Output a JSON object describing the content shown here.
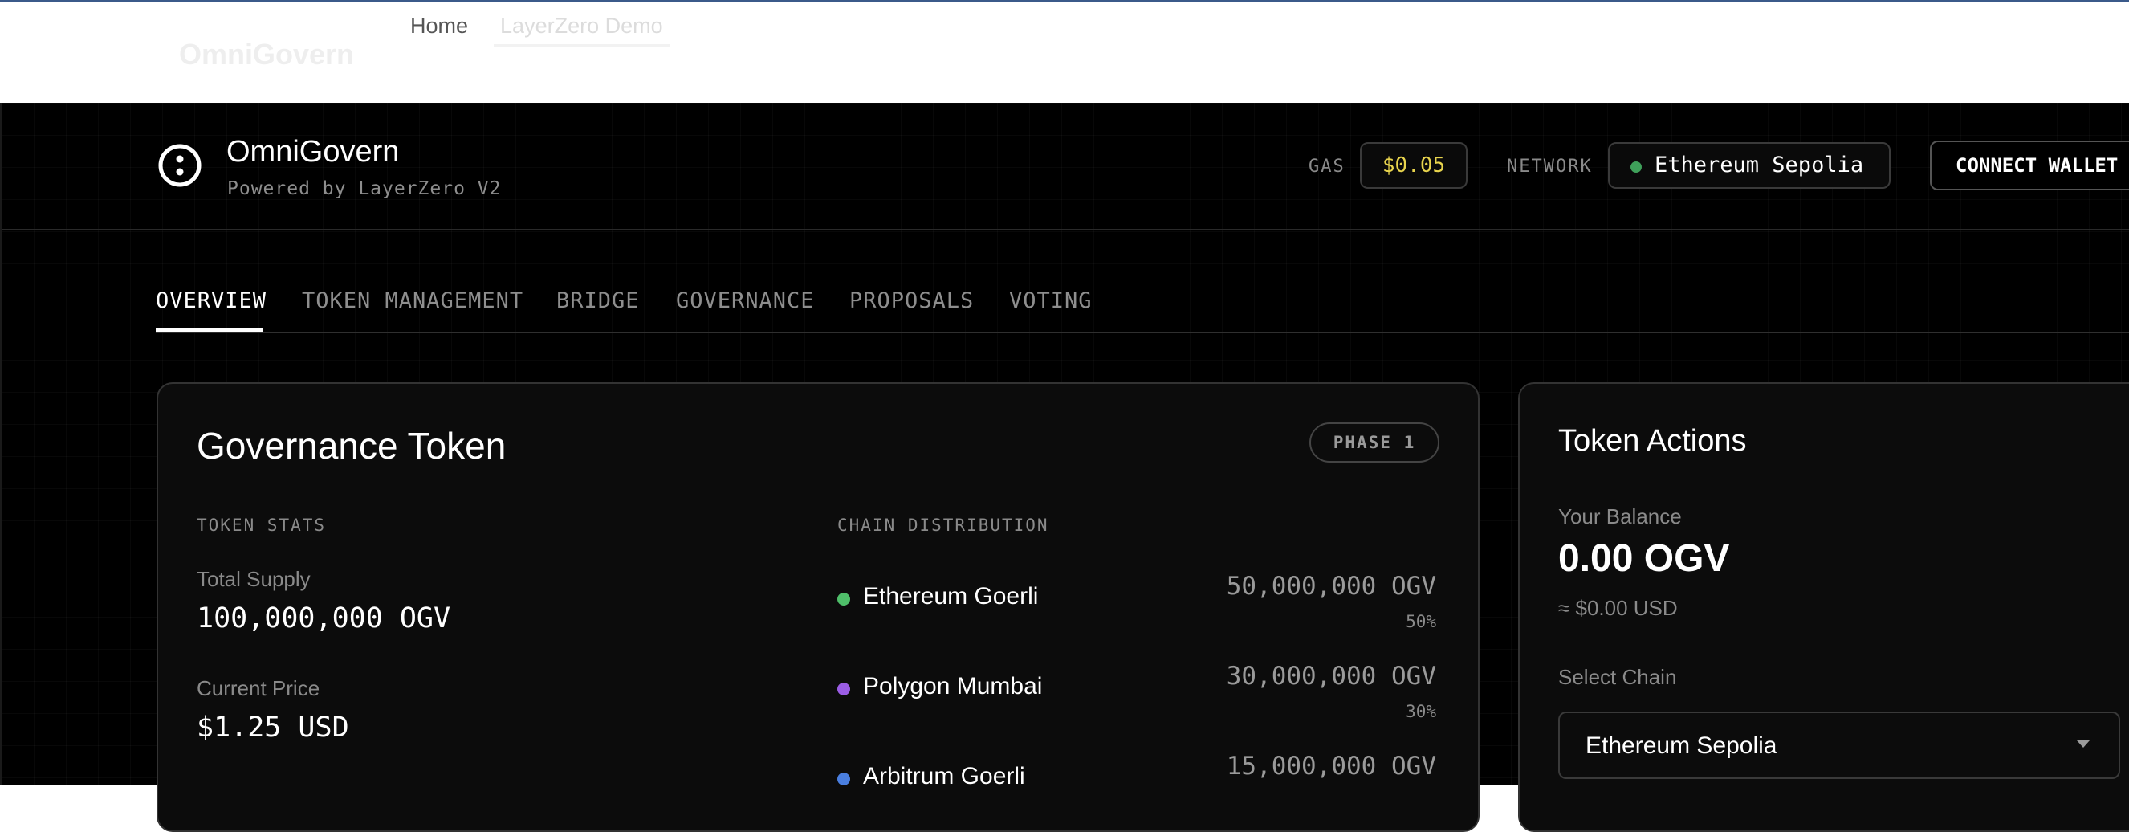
{
  "top_nav": {
    "brand": "OmniGovern",
    "links": [
      {
        "label": "Home"
      },
      {
        "label": "LayerZero Demo"
      }
    ]
  },
  "header": {
    "title": "OmniGovern",
    "subtitle": "Powered by LayerZero V2",
    "gas_label": "GAS",
    "gas_value": "$0.05",
    "network_label": "NETWORK",
    "network_value": "Ethereum Sepolia",
    "connect_label": "CONNECT WALLET"
  },
  "tabs": [
    {
      "label": "OVERVIEW",
      "active": true
    },
    {
      "label": "TOKEN MANAGEMENT"
    },
    {
      "label": "BRIDGE"
    },
    {
      "label": "GOVERNANCE"
    },
    {
      "label": "PROPOSALS"
    },
    {
      "label": "VOTING"
    }
  ],
  "governance": {
    "title": "Governance Token",
    "badge": "PHASE 1",
    "stats_heading": "TOKEN STATS",
    "total_supply_label": "Total Supply",
    "total_supply_value": "100,000,000 OGV",
    "price_label": "Current Price",
    "price_value": "$1.25 USD",
    "distribution_heading": "CHAIN DISTRIBUTION",
    "chains": [
      {
        "name": "Ethereum Goerli",
        "amount": "50,000,000 OGV",
        "pct": "50%",
        "color": "#4fbf6a"
      },
      {
        "name": "Polygon Mumbai",
        "amount": "30,000,000 OGV",
        "pct": "30%",
        "color": "#9b5de5"
      },
      {
        "name": "Arbitrum Goerli",
        "amount": "15,000,000 OGV",
        "pct": "",
        "color": "#4a7fe0"
      }
    ]
  },
  "token_actions": {
    "title": "Token Actions",
    "balance_label": "Your Balance",
    "balance_value": "0.00 OGV",
    "balance_usd": "≈ $0.00 USD",
    "select_chain_label": "Select Chain",
    "select_chain_value": "Ethereum Sepolia"
  }
}
